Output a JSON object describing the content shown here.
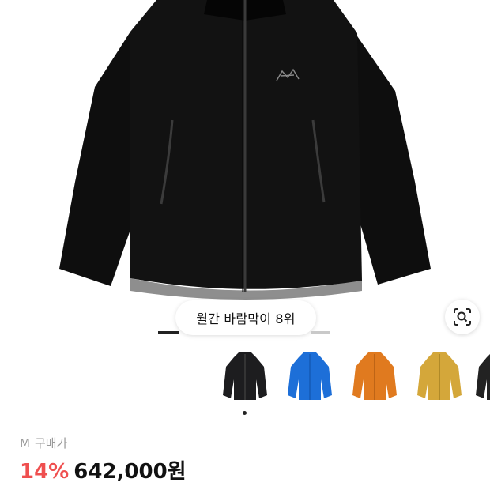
{
  "product": {
    "rank_badge": "월간 바람막이 8위",
    "option_label": "M",
    "price_label": "구매가",
    "discount": "14%",
    "price": "642,000원"
  },
  "colors": {
    "discount": "#ef4f4f",
    "thumb_black": "#1d1d1f",
    "thumb_blue": "#1d6fd8",
    "thumb_orange": "#e07a1f",
    "thumb_mustard": "#d4a73a",
    "thumb_black_2": "#222222"
  },
  "thumbnails": [
    "black",
    "blue",
    "orange",
    "mustard",
    "black"
  ],
  "icons": {
    "lens": "image-search-icon"
  }
}
